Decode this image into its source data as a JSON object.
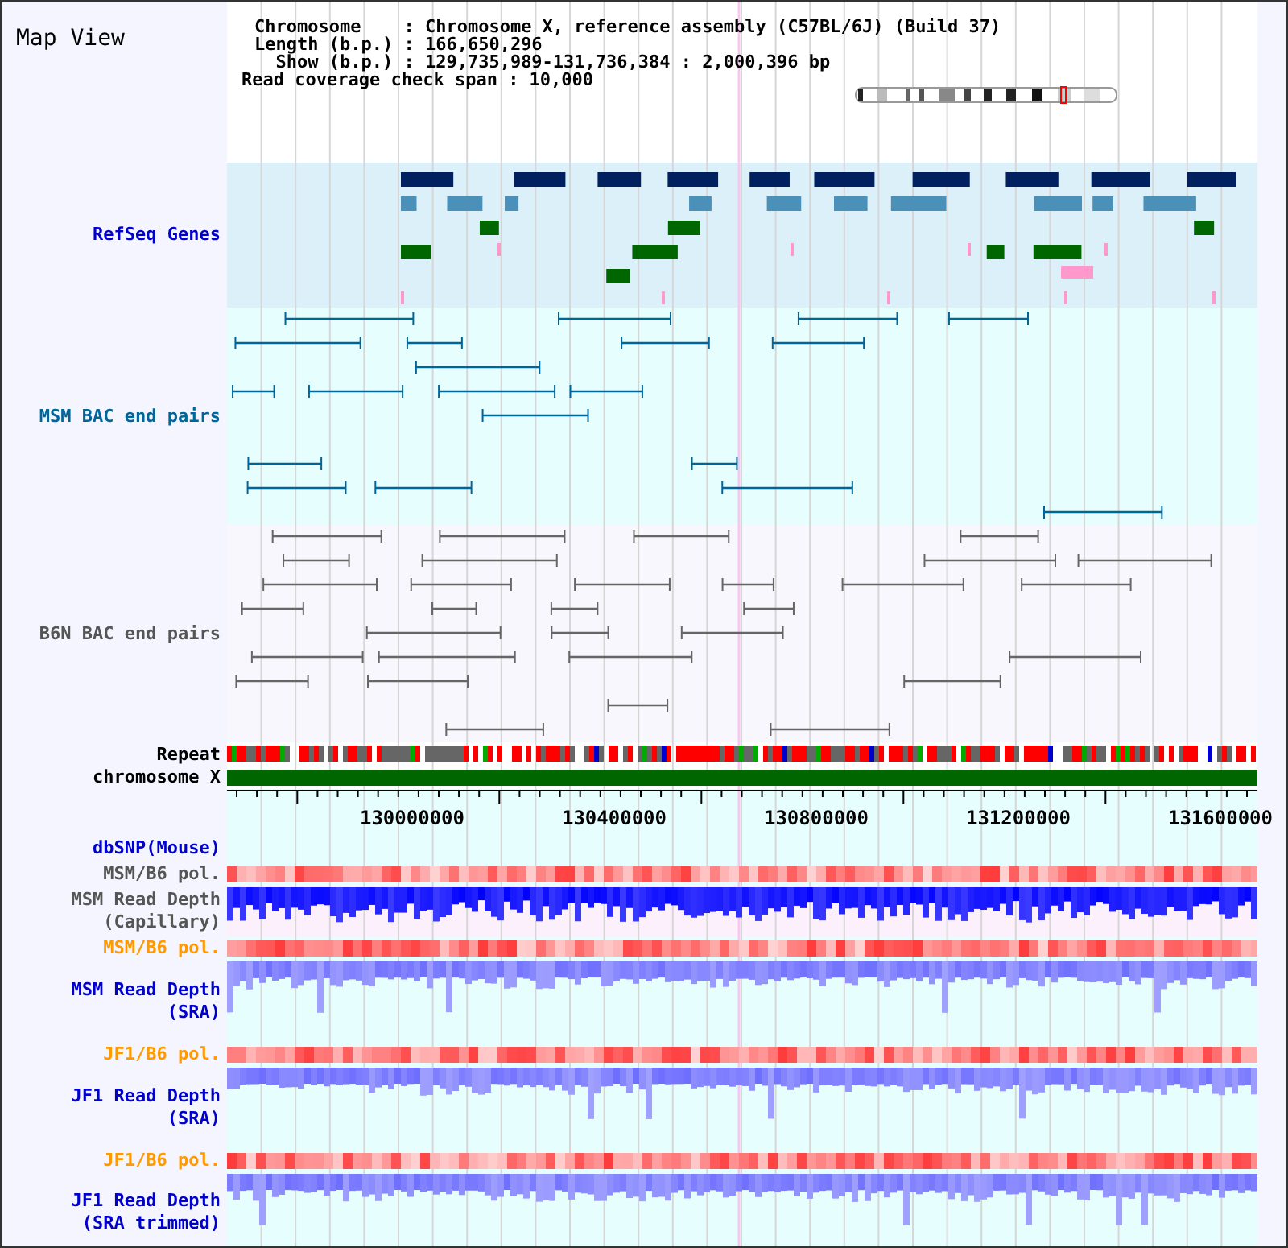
{
  "title": "Map View",
  "info": [
    "Chromosome    : Chromosome X, reference assembly (C57BL/6J) (Build 37)",
    "Length (b.p.) : 166,650,296",
    "  Show (b.p.) : 129,735,989-131,736,384 : 2,000,396 bp",
    "Read coverage check span : 10,000"
  ],
  "tracks": [
    {
      "kind": "genes",
      "label": [
        "RefSeq Genes"
      ],
      "color": "#0000cc"
    },
    {
      "kind": "bac",
      "label": [
        "MSM BAC end pairs"
      ],
      "color": "#006699"
    },
    {
      "kind": "bac2",
      "label": [
        "B6N BAC end pairs"
      ],
      "color": "#555555"
    },
    {
      "kind": "repeat",
      "label": [
        "Repeat"
      ],
      "color": "#000000"
    },
    {
      "kind": "chromosome",
      "label": [
        "chromosome X"
      ],
      "color": "#000000"
    },
    {
      "kind": "axis",
      "ticks": [
        "130000000",
        "130400000",
        "130800000",
        "131200000",
        "131600000"
      ]
    },
    {
      "kind": "section",
      "label": [
        "dbSNP(Mouse)"
      ],
      "color": "#0000cc"
    },
    {
      "kind": "pol",
      "label": [
        "MSM/B6 pol."
      ],
      "color": "#555555"
    },
    {
      "kind": "capillary",
      "label": [
        "MSM Read Depth",
        "(Capillary)"
      ],
      "color": "#555555"
    },
    {
      "kind": "pol",
      "label": [
        "MSM/B6 pol."
      ],
      "color": "#ff9900"
    },
    {
      "kind": "depth",
      "label": [
        "MSM Read Depth",
        "(SRA)"
      ],
      "color": "#0000cc"
    },
    {
      "kind": "pol",
      "label": [
        "JF1/B6 pol."
      ],
      "color": "#ff9900"
    },
    {
      "kind": "depth",
      "label": [
        "JF1 Read Depth",
        "(SRA)"
      ],
      "color": "#0000cc"
    },
    {
      "kind": "pol",
      "label": [
        "JF1/B6 pol."
      ],
      "color": "#ff9900"
    },
    {
      "kind": "depth",
      "label": [
        "JF1 Read Depth",
        "(SRA trimmed)"
      ],
      "color": "#0000cc"
    }
  ]
}
